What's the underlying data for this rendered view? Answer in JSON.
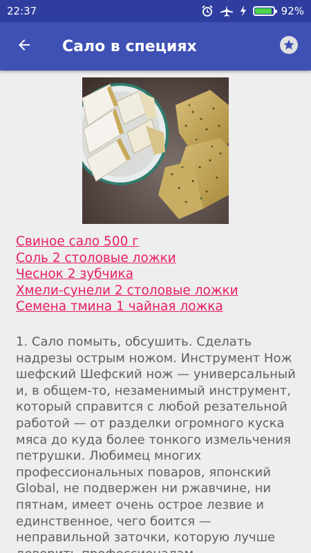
{
  "status_bar": {
    "time": "22:37",
    "battery_percent_label": "92%",
    "battery_level": 0.92,
    "icons": [
      "alarm-icon",
      "airplane-mode-icon",
      "charging-icon",
      "battery-icon"
    ]
  },
  "app_bar": {
    "title": "Сало в специях",
    "back_icon": "arrow-left-icon",
    "favorite_icon": "star-icon",
    "color": "#3f51b5",
    "status_color": "#2f3e9e"
  },
  "recipe": {
    "image": "salo-with-spices-photo",
    "ingredients": [
      "Свиное сало 500 г",
      "Соль 2 столовые ложки",
      "Чеснок 2 зубчика",
      "Хмели-сунели 2 столовые ложки",
      "Семена тмина 1 чайная ложка"
    ],
    "link_color": "#e91e63",
    "steps_text": "1. Сало помыть, обсушить. Сделать надрезы острым ножом. Инструмент Нож шефский Шефский нож — универсальный и, в общем-то, незаменимый инструмент, который справится с любой резательной работой — от разделки огромного куска мяса до куда более тонкого измельчения петрушки. Любимец многих профессиональных поваров, японский Global, не подвержен ни ржавчине, ни пятнам, имеет очень острое лезвие и единственное, чего боится — неправильной заточки, которую лучше доверить профессионалам."
  }
}
